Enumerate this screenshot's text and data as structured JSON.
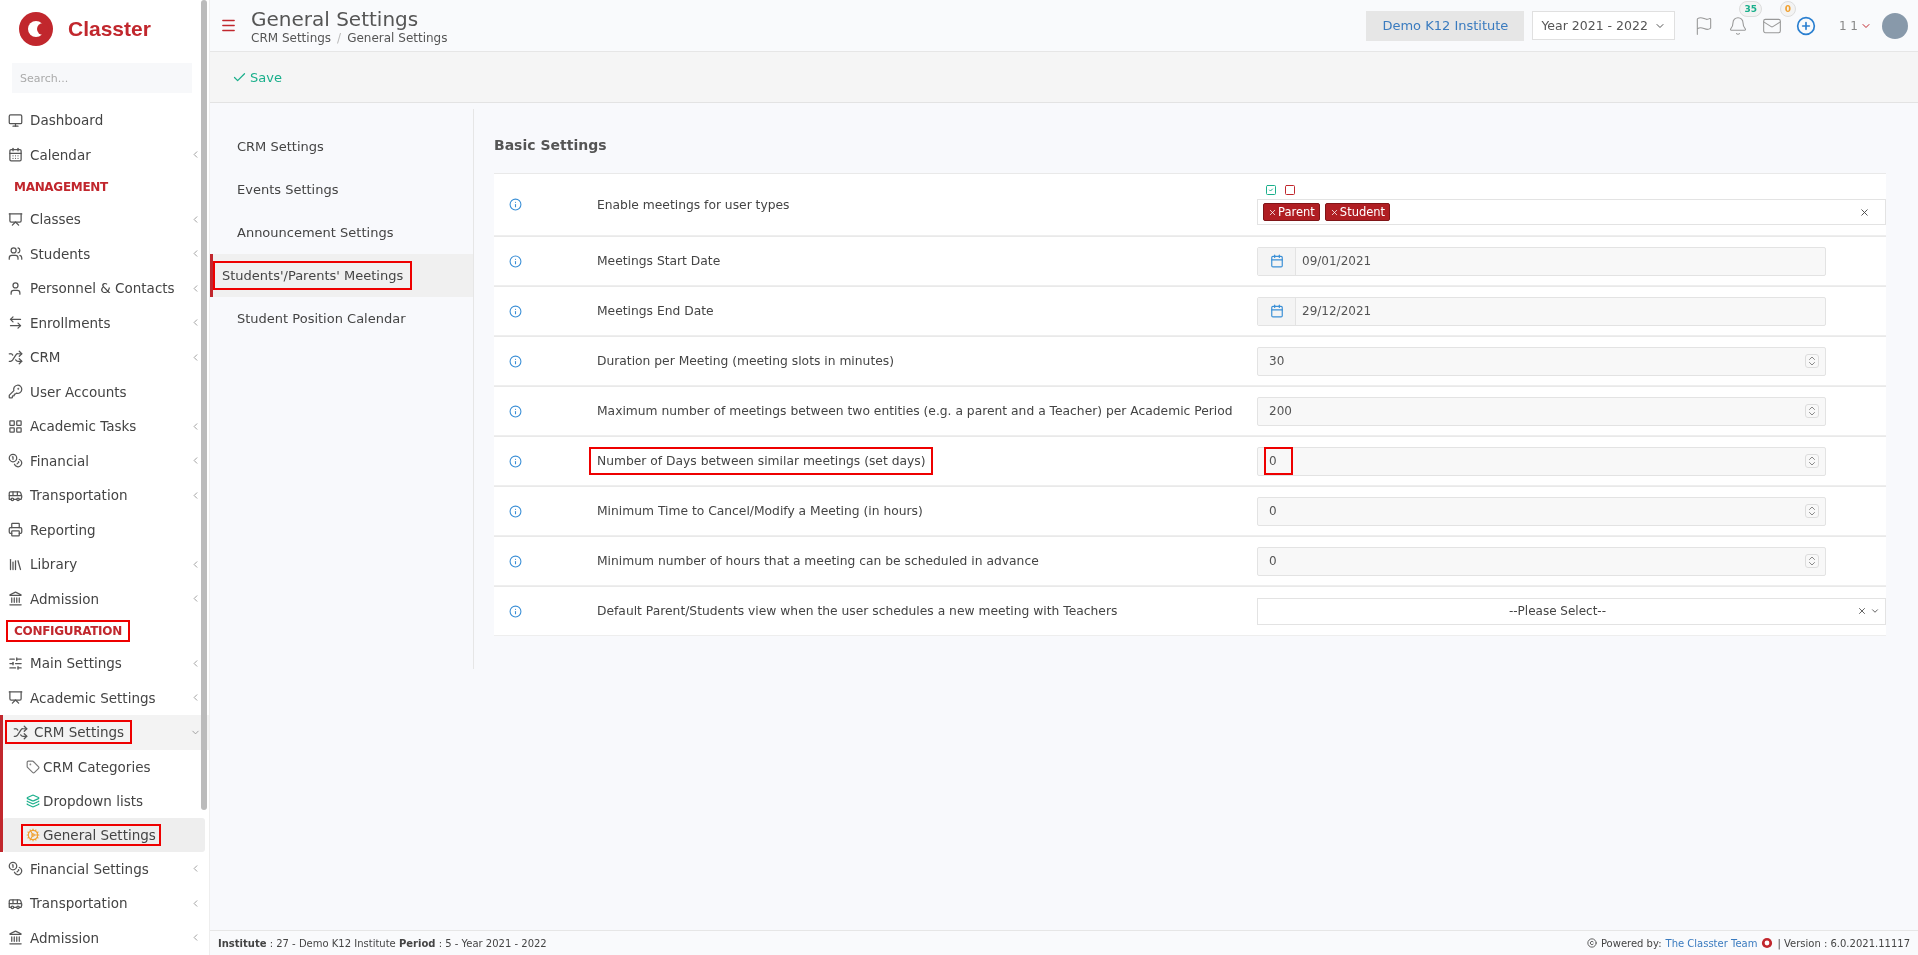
{
  "brand": {
    "name": "Classter"
  },
  "sidebar": {
    "search_placeholder": "Search...",
    "items": [
      {
        "kind": "link",
        "label": "Dashboard",
        "has_submenu": false
      },
      {
        "kind": "link",
        "label": "Calendar",
        "has_submenu": true
      },
      {
        "kind": "heading",
        "label": "MANAGEMENT",
        "highlighted": false
      },
      {
        "kind": "link",
        "label": "Classes",
        "has_submenu": true
      },
      {
        "kind": "link",
        "label": "Students",
        "has_submenu": true
      },
      {
        "kind": "link",
        "label": "Personnel & Contacts",
        "has_submenu": true
      },
      {
        "kind": "link",
        "label": "Enrollments",
        "has_submenu": true
      },
      {
        "kind": "link",
        "label": "CRM",
        "has_submenu": true
      },
      {
        "kind": "link",
        "label": "User Accounts",
        "has_submenu": false
      },
      {
        "kind": "link",
        "label": "Academic Tasks",
        "has_submenu": true
      },
      {
        "kind": "link",
        "label": "Financial",
        "has_submenu": true
      },
      {
        "kind": "link",
        "label": "Transportation",
        "has_submenu": true
      },
      {
        "kind": "link",
        "label": "Reporting",
        "has_submenu": false
      },
      {
        "kind": "link",
        "label": "Library",
        "has_submenu": true
      },
      {
        "kind": "link",
        "label": "Admission",
        "has_submenu": true
      },
      {
        "kind": "heading",
        "label": "CONFIGURATION",
        "highlighted": true
      },
      {
        "kind": "link",
        "label": "Main Settings",
        "has_submenu": true
      },
      {
        "kind": "link",
        "label": "Academic Settings",
        "has_submenu": true
      },
      {
        "kind": "group",
        "label": "CRM Settings",
        "highlighted": true,
        "expanded": true,
        "children": [
          {
            "label": "CRM Categories",
            "selected": false,
            "highlighted": false
          },
          {
            "label": "Dropdown lists",
            "selected": false,
            "highlighted": false
          },
          {
            "label": "General Settings",
            "selected": true,
            "highlighted": true
          }
        ]
      },
      {
        "kind": "link",
        "label": "Financial Settings",
        "has_submenu": true
      },
      {
        "kind": "link",
        "label": "Transportation",
        "has_submenu": true
      },
      {
        "kind": "link",
        "label": "Admission",
        "has_submenu": true
      }
    ]
  },
  "header": {
    "title": "General Settings",
    "breadcrumb": [
      "CRM Settings",
      "General Settings"
    ],
    "breadcrumb_separator": "/",
    "institute": "Demo K12 Institute",
    "year": "Year 2021 - 2022",
    "notifications": "35",
    "messages": "0",
    "user": "1 1"
  },
  "toolbar": {
    "save": "Save"
  },
  "settings_menu": [
    {
      "label": "CRM Settings",
      "selected": false,
      "highlighted": false
    },
    {
      "label": "Events Settings",
      "selected": false,
      "highlighted": false
    },
    {
      "label": "Announcement Settings",
      "selected": false,
      "highlighted": false
    },
    {
      "label": "Students'/Parents' Meetings",
      "selected": true,
      "highlighted": true
    },
    {
      "label": "Student Position Calendar",
      "selected": false,
      "highlighted": false
    }
  ],
  "section_title": "Basic Settings",
  "rows": [
    {
      "kind": "tags",
      "label": "Enable meetings for user types",
      "tags": [
        "Parent",
        "Student"
      ],
      "highlighted": false
    },
    {
      "kind": "date",
      "label": "Meetings Start Date",
      "value": "09/01/2021",
      "highlighted": false
    },
    {
      "kind": "date",
      "label": "Meetings End Date",
      "value": "29/12/2021",
      "highlighted": false
    },
    {
      "kind": "number",
      "label": "Duration per Meeting (meeting slots in minutes)",
      "value": "30",
      "highlighted": false
    },
    {
      "kind": "number",
      "label": "Maximum number of meetings between two entities (e.g. a parent and a Teacher) per Academic Period",
      "value": "200",
      "highlighted": false
    },
    {
      "kind": "number",
      "label": "Number of Days between similar meetings (set days)",
      "value": "0",
      "highlighted": true
    },
    {
      "kind": "number",
      "label": "Minimum Time to Cancel/Modify a Meeting (in hours)",
      "value": "0",
      "highlighted": false
    },
    {
      "kind": "number",
      "label": "Minimum number of hours that a meeting can be scheduled in advance",
      "value": "0",
      "highlighted": false
    },
    {
      "kind": "select",
      "label": "Default Parent/Students view when the user schedules a new meeting with Teachers",
      "placeholder": "--Please Select--",
      "highlighted": false
    }
  ],
  "footer": {
    "period": "**Institute** : 27 - Demo K12 Institute **Period** : 5 - Year 2021 - 2022",
    "powered": "Powered by:",
    "team": "The Classter Team",
    "version": "| Version : 6.0.2021.11117"
  }
}
